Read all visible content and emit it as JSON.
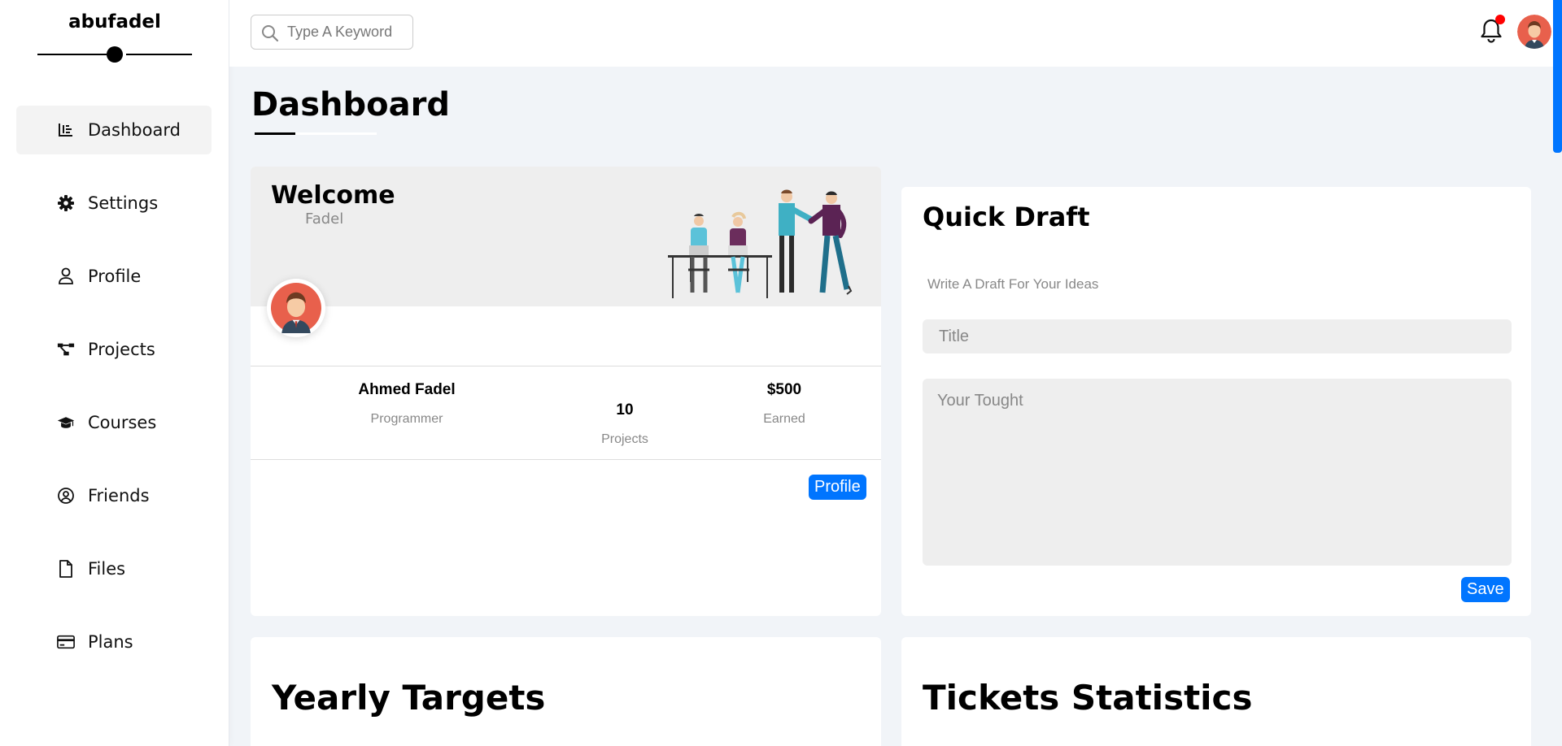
{
  "brand": {
    "name": "abufadel"
  },
  "sidebar": {
    "items": [
      {
        "label": "Dashboard",
        "icon": "chart-icon",
        "active": true
      },
      {
        "label": "Settings",
        "icon": "gear-icon"
      },
      {
        "label": "Profile",
        "icon": "user-icon"
      },
      {
        "label": "Projects",
        "icon": "diagram-icon"
      },
      {
        "label": "Courses",
        "icon": "graduation-cap-icon"
      },
      {
        "label": "Friends",
        "icon": "user-circle-icon"
      },
      {
        "label": "Files",
        "icon": "file-icon"
      },
      {
        "label": "Plans",
        "icon": "credit-card-icon"
      }
    ]
  },
  "header": {
    "search_placeholder": "Type A Keyword",
    "notification_icon": "bell-icon",
    "avatar_icon": "avatar-icon"
  },
  "page": {
    "title": "Dashboard"
  },
  "welcome": {
    "title": "Welcome",
    "name": "Fadel",
    "stats": [
      {
        "value": "Ahmed Fadel",
        "label": "Programmer"
      },
      {
        "value": "10",
        "label": "Projects"
      },
      {
        "value": "$500",
        "label": "Earned"
      }
    ],
    "profile_button": "Profile"
  },
  "draft": {
    "title": "Quick Draft",
    "subtitle": "Write A Draft For Your Ideas",
    "title_placeholder": "Title",
    "body_placeholder": "Your Tought",
    "save_button": "Save"
  },
  "sections": {
    "yearly_title": "Yearly Targets",
    "tickets_title": "Tickets Statistics"
  },
  "colors": {
    "accent": "#0075ff",
    "page_bg": "#f1f4f8",
    "notification_dot": "#ff0000"
  }
}
